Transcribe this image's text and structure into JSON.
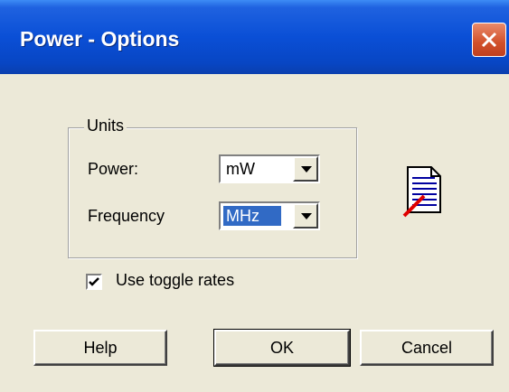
{
  "window": {
    "title": "Power - Options"
  },
  "titlebar_colors": {
    "start": "#3d8df5",
    "end": "#0a3fae"
  },
  "units_group": {
    "label": "Units",
    "power": {
      "label": "Power:",
      "value": "mW"
    },
    "frequency": {
      "label": "Frequency",
      "value": "MHz"
    }
  },
  "toggle": {
    "label": "Use toggle rates",
    "checked": true
  },
  "buttons": {
    "help": "Help",
    "ok": "OK",
    "cancel": "Cancel"
  },
  "icons": {
    "close": "close-icon",
    "document": "document-edit-icon",
    "check": "checkmark-icon"
  },
  "colors": {
    "background": "#ece9d8",
    "selection": "#316ac5",
    "close_button": "#d1502a"
  }
}
